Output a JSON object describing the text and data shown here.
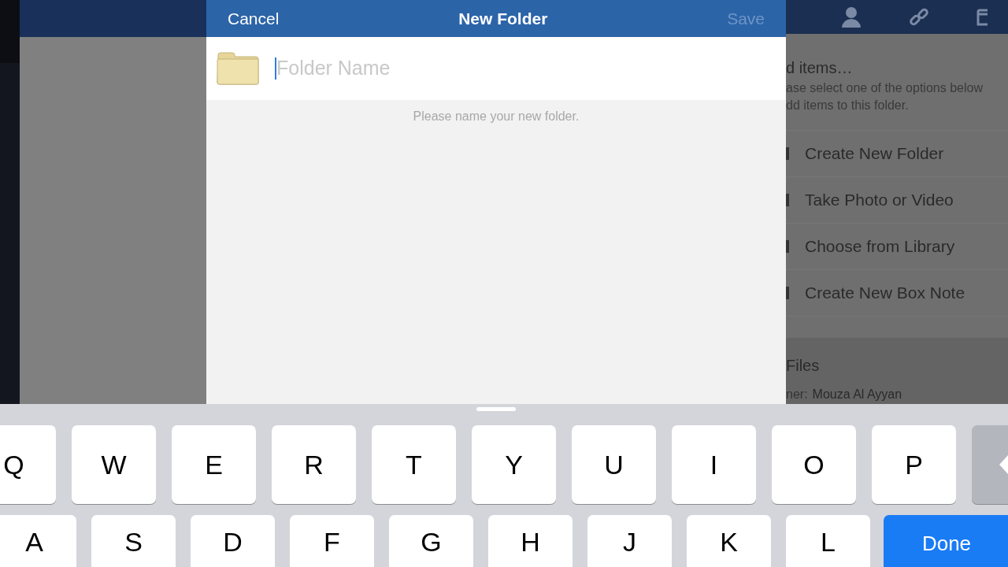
{
  "dialog": {
    "cancel": "Cancel",
    "title": "New Folder",
    "save": "Save",
    "save_disabled": true,
    "name_field": {
      "placeholder": "Folder Name"
    },
    "hint": "Please name your new folder."
  },
  "background_panel": {
    "heading": "d items…",
    "description_lines": [
      "ase select one of the options below",
      "dd items to this folder."
    ],
    "options": [
      {
        "label": "Create New Folder"
      },
      {
        "label": "Take Photo or Video"
      },
      {
        "label": "Choose from Library"
      },
      {
        "label": "Create New Box Note"
      }
    ],
    "section_title": "Files",
    "owner_label": "ner:",
    "owner": "Mouza Al Ayyan"
  },
  "keyboard": {
    "row_1": [
      "Q",
      "W",
      "E",
      "R",
      "T",
      "Y",
      "U",
      "I",
      "O",
      "P"
    ],
    "row_2": [
      "A",
      "S",
      "D",
      "F",
      "G",
      "H",
      "J",
      "K",
      "L"
    ],
    "done": "Done"
  }
}
